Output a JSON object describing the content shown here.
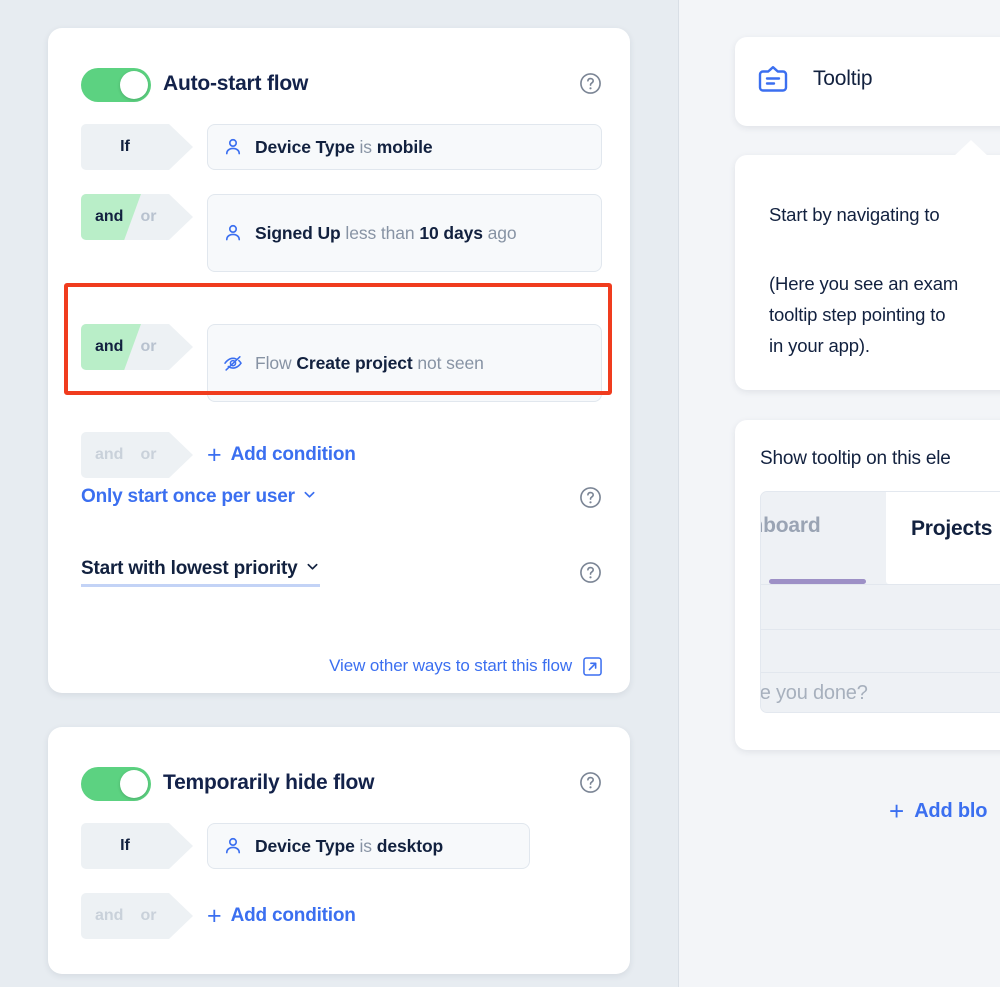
{
  "theme": {
    "background": "#e7ecf1",
    "right_panel_bg": "#f3f5f8",
    "accent_blue": "#3b6ff0",
    "toggle_green": "#5cd281",
    "tag_green": "#b9eec8",
    "highlight_red": "#f03c1e",
    "text_dark": "#12213f",
    "text_muted": "#8793a4"
  },
  "autostart_card": {
    "toggle_label": "Auto-start flow",
    "toggle_on": true,
    "help_icon": "question-circle-icon",
    "conditions": [
      {
        "connector": "if",
        "connector_label": "If",
        "icon": "user-icon",
        "parts": [
          {
            "text": "Device Type",
            "style": "bold"
          },
          {
            "text": "is",
            "style": "muted"
          },
          {
            "text": "mobile",
            "style": "bold"
          }
        ]
      },
      {
        "connector": "and",
        "and_label": "and",
        "or_label": "or",
        "icon": "user-icon",
        "parts": [
          {
            "text": "Signed Up",
            "style": "bold"
          },
          {
            "text": "less than",
            "style": "muted"
          },
          {
            "text": "10 days",
            "style": "bold"
          },
          {
            "text": "ago",
            "style": "muted"
          }
        ]
      },
      {
        "connector": "and",
        "and_label": "and",
        "or_label": "or",
        "icon": "eye-slash-icon",
        "highlighted": true,
        "parts": [
          {
            "text": "Flow",
            "style": "muted"
          },
          {
            "text": "Create project",
            "style": "bold"
          },
          {
            "text": "not seen",
            "style": "muted"
          }
        ]
      }
    ],
    "add_condition": {
      "and_label": "and",
      "or_label": "or",
      "plus": "+",
      "label": "Add condition"
    },
    "frequency_select": {
      "label": "Only start once per user",
      "chevron": "chevron-down-icon",
      "help_icon": "question-circle-icon"
    },
    "priority_select": {
      "label": "Start with lowest priority",
      "chevron": "chevron-down-icon",
      "help_icon": "question-circle-icon"
    },
    "view_other_link": {
      "label": "View other ways to start this flow",
      "icon": "external-link-icon"
    }
  },
  "hide_card": {
    "toggle_label": "Temporarily hide flow",
    "toggle_on": true,
    "help_icon": "question-circle-icon",
    "conditions": [
      {
        "connector": "if",
        "connector_label": "If",
        "icon": "user-icon",
        "parts": [
          {
            "text": "Device Type",
            "style": "bold"
          },
          {
            "text": "is",
            "style": "muted"
          },
          {
            "text": "desktop",
            "style": "bold"
          }
        ]
      }
    ],
    "add_condition": {
      "and_label": "and",
      "or_label": "or",
      "plus": "+",
      "label": "Add condition"
    }
  },
  "right_panel": {
    "block_header": {
      "icon": "tooltip-icon",
      "title": "Tooltip"
    },
    "tooltip_preview": {
      "paragraph_1": "Start by navigating to",
      "paragraph_2": "(Here you see an exam",
      "paragraph_3": "tooltip step pointing to",
      "paragraph_4": "in your app)."
    },
    "element_picker": {
      "label": "Show tooltip on this ele",
      "mock_tab_inactive": "shboard",
      "mock_tab_active": "Projects",
      "mock_placeholder": "ave you done?"
    },
    "add_block": {
      "plus": "+",
      "label": "Add blo"
    }
  }
}
